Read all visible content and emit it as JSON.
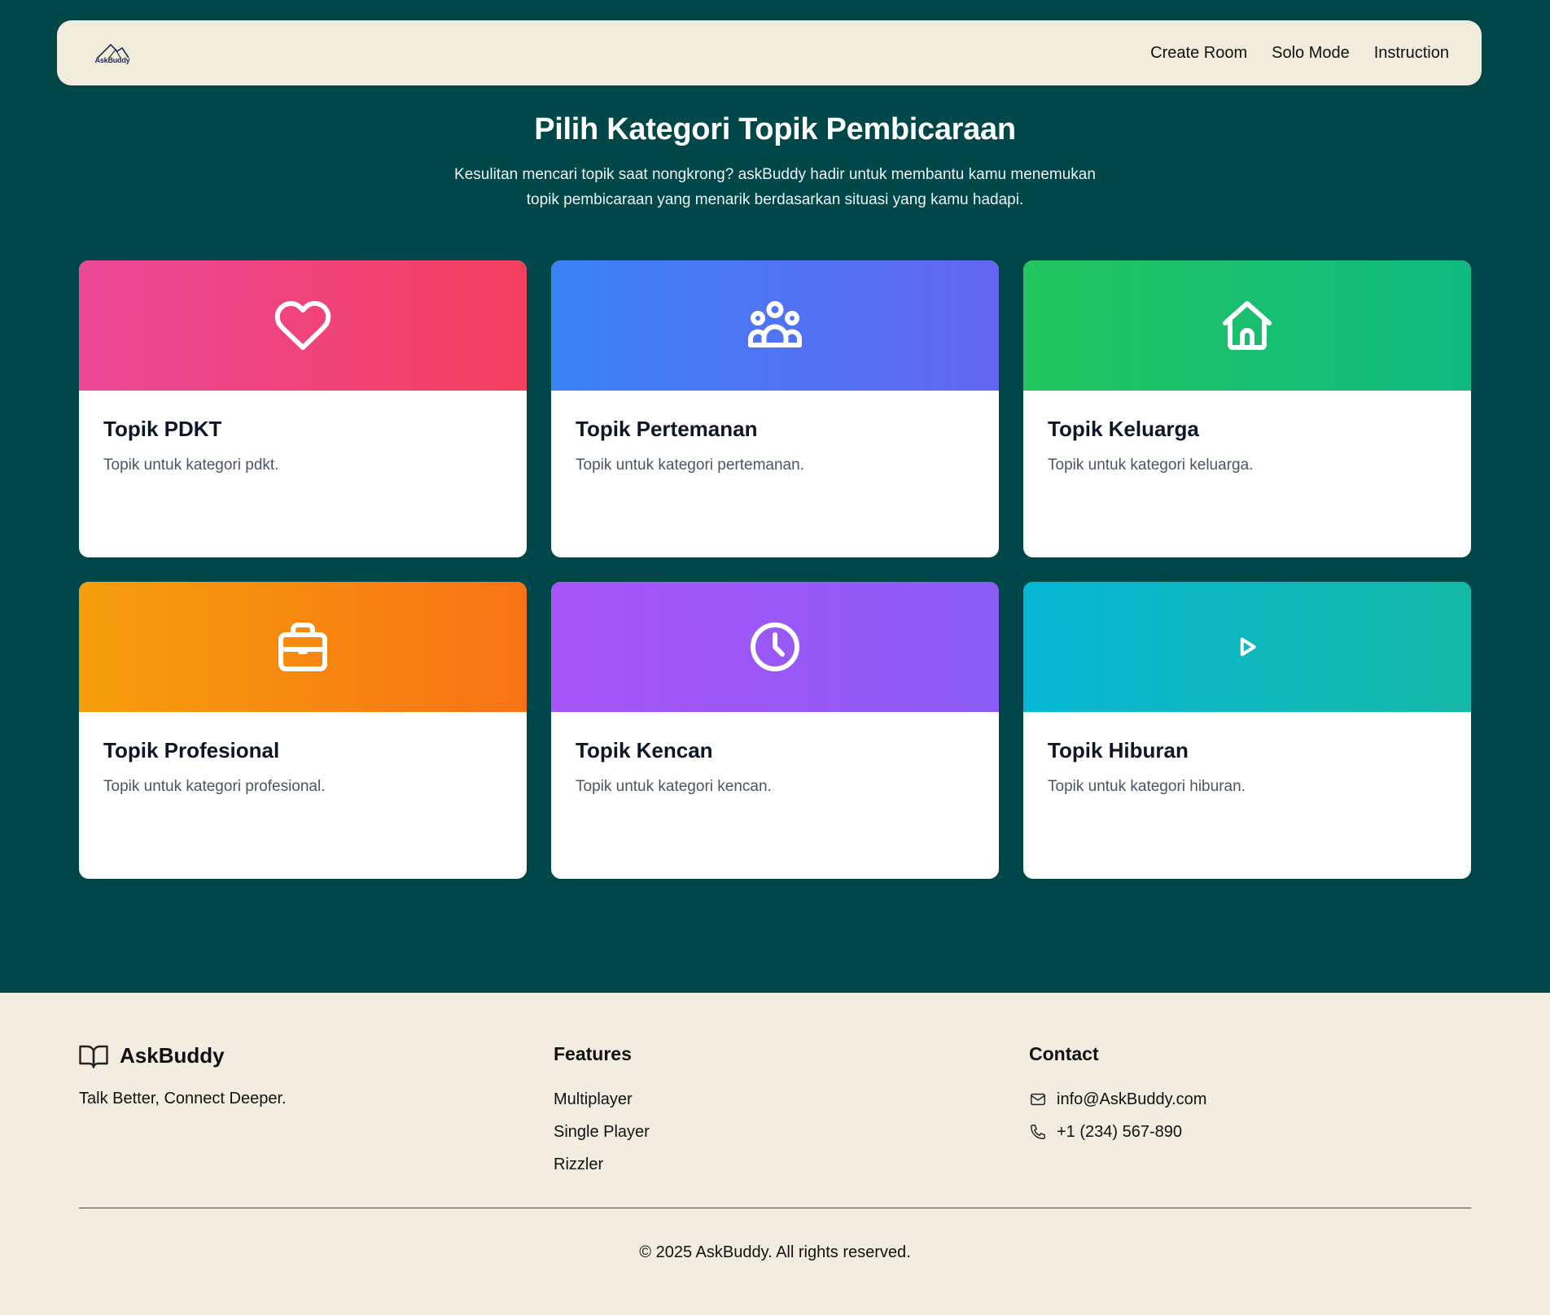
{
  "nav": {
    "logo_text": "AskBuddy",
    "links": [
      "Create Room",
      "Solo Mode",
      "Instruction"
    ]
  },
  "hero": {
    "title": "Pilih Kategori Topik Pembicaraan",
    "subtitle": "Kesulitan mencari topik saat nongkrong? askBuddy hadir untuk membantu kamu menemukan topik pembicaraan yang menarik berdasarkan situasi yang kamu hadapi."
  },
  "categories": [
    {
      "title": "Topik PDKT",
      "desc": "Topik untuk kategori pdkt.",
      "icon": "heart-icon",
      "colors": [
        "#ec4899",
        "#f43f5e"
      ]
    },
    {
      "title": "Topik Pertemanan",
      "desc": "Topik untuk kategori pertemanan.",
      "icon": "users-icon",
      "colors": [
        "#3b82f6",
        "#6366f1"
      ]
    },
    {
      "title": "Topik Keluarga",
      "desc": "Topik untuk kategori keluarga.",
      "icon": "home-icon",
      "colors": [
        "#22c55e",
        "#10b981"
      ]
    },
    {
      "title": "Topik Profesional",
      "desc": "Topik untuk kategori profesional.",
      "icon": "briefcase-icon",
      "colors": [
        "#f59e0b",
        "#f97316"
      ]
    },
    {
      "title": "Topik Kencan",
      "desc": "Topik untuk kategori kencan.",
      "icon": "clock-icon",
      "colors": [
        "#a855f7",
        "#8b5cf6"
      ]
    },
    {
      "title": "Topik Hiburan",
      "desc": "Topik untuk kategori hiburan.",
      "icon": "play-icon",
      "colors": [
        "#06b6d4",
        "#14b8a6"
      ]
    }
  ],
  "footer": {
    "brand": "AskBuddy",
    "tagline": "Talk Better, Connect Deeper.",
    "features_title": "Features",
    "features": [
      "Multiplayer",
      "Single Player",
      "Rizzler"
    ],
    "contact_title": "Contact",
    "email": "info@AskBuddy.com",
    "phone": "+1 (234) 567-890",
    "copyright": "© 2025 AskBuddy. All rights reserved."
  }
}
